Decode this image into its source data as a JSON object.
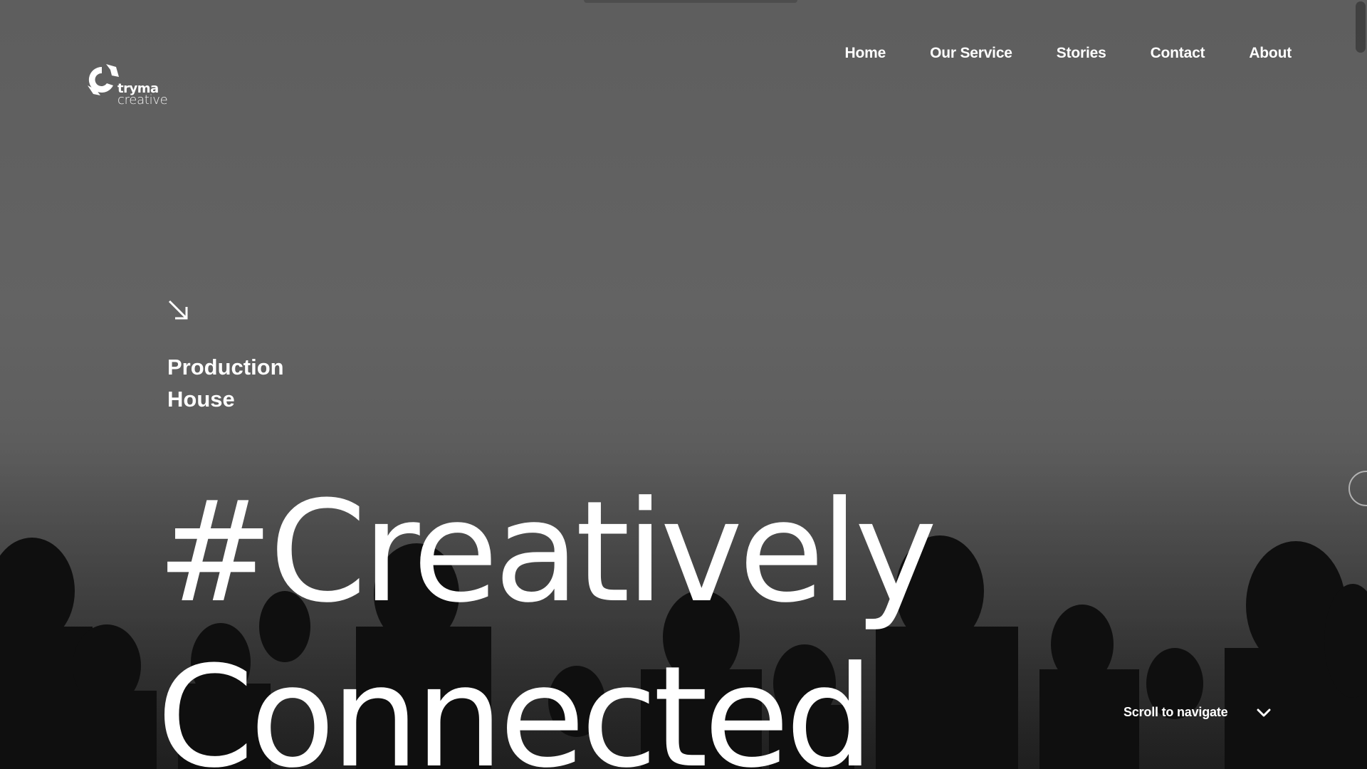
{
  "brand": {
    "name_line1": "tryma",
    "name_line2": "creative"
  },
  "nav": {
    "items": [
      {
        "label": "Home"
      },
      {
        "label": "Our Service"
      },
      {
        "label": "Stories"
      },
      {
        "label": "Contact"
      },
      {
        "label": "About"
      }
    ]
  },
  "hero": {
    "tagline_line1": "Production",
    "tagline_line2": "House",
    "headline_line1": "#Creatively",
    "headline_line2": "Connected",
    "arrow_icon": "arrow-down-right-icon"
  },
  "scroll": {
    "label": "Scroll to navigate",
    "icon": "chevron-down-icon"
  },
  "colors": {
    "text": "#ffffff",
    "background": "#5f5f5f",
    "silhouette": "#0e0e0e"
  }
}
